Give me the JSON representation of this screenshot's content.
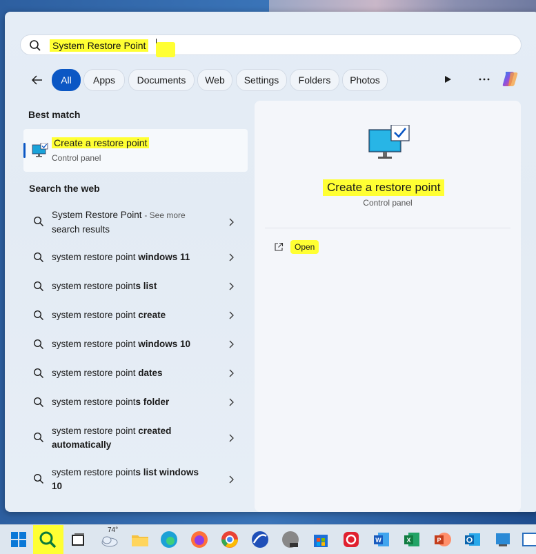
{
  "search": {
    "query": "System Restore Point"
  },
  "filters": [
    "All",
    "Apps",
    "Documents",
    "Web",
    "Settings",
    "Folders",
    "Photos"
  ],
  "best_match": {
    "heading": "Best match",
    "title": "Create a restore point",
    "subtitle": "Control panel"
  },
  "web": {
    "heading": "Search the web",
    "first": {
      "text": "System Restore Point",
      "see_more": "- See more",
      "see_more2": "search results"
    },
    "items": [
      {
        "pre": "system restore point ",
        "bold": "windows 11"
      },
      {
        "pre": "system restore point",
        "bold": "s list"
      },
      {
        "pre": "system restore point ",
        "bold": "create"
      },
      {
        "pre": "system restore point ",
        "bold": "windows 10"
      },
      {
        "pre": "system restore point ",
        "bold": "dates"
      },
      {
        "pre": "system restore point",
        "bold": "s folder"
      }
    ],
    "two_line": [
      {
        "pre": "system restore point ",
        "bold": "created",
        "line2": "automatically",
        "line2_bold": true
      },
      {
        "pre": "system restore point",
        "bold": "s list windows",
        "line2": "10",
        "line2_bold": true
      }
    ]
  },
  "detail": {
    "title": "Create a restore point",
    "subtitle": "Control panel",
    "open_label": "Open"
  },
  "taskbar": {
    "weather": "74°"
  },
  "colors": {
    "accent": "#0b57c4",
    "highlight": "#ffff33"
  }
}
